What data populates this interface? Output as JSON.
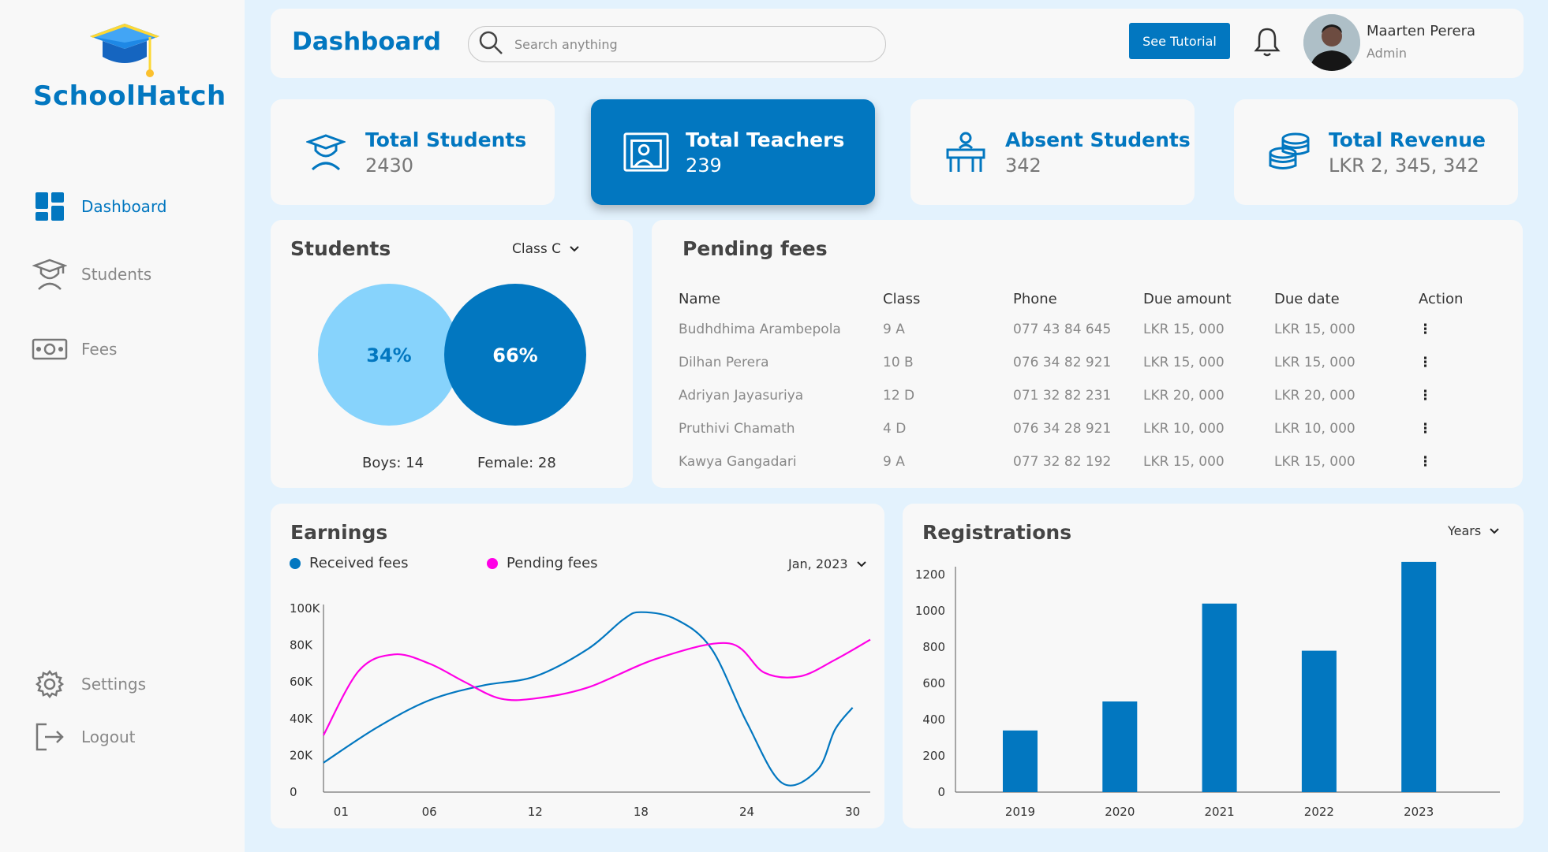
{
  "brand": {
    "name": "SchoolHatch"
  },
  "sidebar": {
    "items": [
      {
        "label": "Dashboard",
        "icon": "dashboard-icon",
        "active": true
      },
      {
        "label": "Students",
        "icon": "graduate-icon",
        "active": false
      },
      {
        "label": "Fees",
        "icon": "money-icon",
        "active": false
      }
    ],
    "bottom": [
      {
        "label": "Settings",
        "icon": "gear-icon"
      },
      {
        "label": "Logout",
        "icon": "logout-icon"
      }
    ]
  },
  "header": {
    "title": "Dashboard",
    "search_placeholder": "Search anything",
    "tutorial_label": "See Tutorial",
    "user": {
      "name": "Maarten Perera",
      "role": "Admin"
    }
  },
  "stats": [
    {
      "label": "Total Students",
      "value": "2430",
      "icon": "student-icon"
    },
    {
      "label": "Total Teachers",
      "value": "239",
      "icon": "teacher-board-icon"
    },
    {
      "label": "Absent Students",
      "value": "342",
      "icon": "desk-icon"
    },
    {
      "label": "Total Revenue",
      "value": "LKR 2, 345, 342",
      "icon": "coins-icon"
    }
  ],
  "students_panel": {
    "title": "Students",
    "filter": "Class C",
    "boys_pct": "34%",
    "female_pct": "66%",
    "boys_label": "Boys: 14",
    "female_label": "Female: 28"
  },
  "pending_fees": {
    "title": "Pending fees",
    "columns": [
      "Name",
      "Class",
      "Phone",
      "Due amount",
      "Due date",
      "Action"
    ],
    "rows": [
      [
        "Budhdhima Arambepola",
        "9 A",
        "077 43 84 645",
        "LKR 15, 000",
        "LKR 15, 000"
      ],
      [
        "Dilhan Perera",
        "10 B",
        "076 34 82 921",
        "LKR 15, 000",
        "LKR 15, 000"
      ],
      [
        "Adriyan Jayasuriya",
        "12 D",
        "071 32 82 231",
        "LKR 20, 000",
        "LKR 20, 000"
      ],
      [
        "Pruthivi Chamath",
        "4 D",
        "076 34 28 921",
        "LKR 10, 000",
        "LKR 10, 000"
      ],
      [
        "Kawya Gangadari",
        "9 A",
        "077 32 82 192",
        "LKR 15, 000",
        "LKR 15, 000"
      ]
    ]
  },
  "earnings": {
    "title": "Earnings",
    "legend": [
      "Received fees",
      "Pending fees"
    ],
    "filter": "Jan, 2023"
  },
  "registrations": {
    "title": "Registrations",
    "filter": "Years"
  },
  "colors": {
    "accent": "#0277c0",
    "light": "#87d3fc",
    "pending": "#ff00e6"
  },
  "chart_data": [
    {
      "type": "line",
      "title": "Earnings",
      "x_ticks": [
        "01",
        "06",
        "12",
        "18",
        "24",
        "30"
      ],
      "y_ticks": [
        "0",
        "20K",
        "40K",
        "60K",
        "80K",
        "100K"
      ],
      "ylim": [
        0,
        100000
      ],
      "xlim": [
        0,
        31
      ],
      "series": [
        {
          "name": "Received fees",
          "color": "#0277c0",
          "x": [
            0,
            3,
            6,
            9,
            12,
            15,
            17,
            18,
            20,
            22,
            24,
            26,
            28,
            29,
            30
          ],
          "y": [
            16000,
            35000,
            50000,
            58000,
            63000,
            78000,
            94000,
            98000,
            94000,
            78000,
            38000,
            5000,
            12000,
            34000,
            46000
          ]
        },
        {
          "name": "Pending fees",
          "color": "#ff00e6",
          "x": [
            0,
            2,
            4,
            6,
            8,
            10,
            12,
            15,
            19,
            23,
            25,
            27,
            29,
            31
          ],
          "y": [
            31000,
            66000,
            75000,
            70000,
            60000,
            51000,
            51000,
            57000,
            73000,
            81000,
            65000,
            63000,
            72000,
            83000
          ]
        }
      ]
    },
    {
      "type": "bar",
      "title": "Registrations",
      "categories": [
        "2019",
        "2020",
        "2021",
        "2022",
        "2023"
      ],
      "values": [
        340,
        500,
        1040,
        780,
        1270
      ],
      "y_ticks": [
        "0",
        "200",
        "400",
        "600",
        "800",
        "1000",
        "1200"
      ],
      "ylim": [
        0,
        1200
      ],
      "color": "#0277c0"
    }
  ]
}
